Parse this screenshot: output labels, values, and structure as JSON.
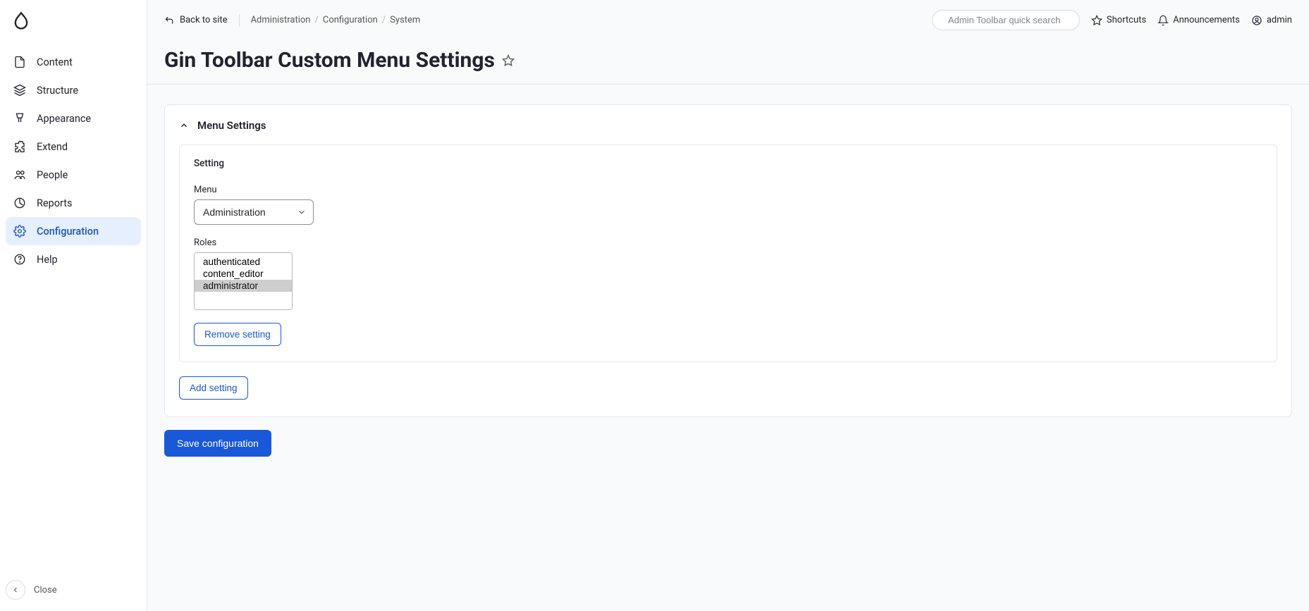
{
  "sidebar": {
    "items": [
      {
        "label": "Content"
      },
      {
        "label": "Structure"
      },
      {
        "label": "Appearance"
      },
      {
        "label": "Extend"
      },
      {
        "label": "People"
      },
      {
        "label": "Reports"
      },
      {
        "label": "Configuration"
      },
      {
        "label": "Help"
      }
    ],
    "close_label": "Close"
  },
  "topbar": {
    "back_label": "Back to site",
    "breadcrumbs": [
      "Administration",
      "Configuration",
      "System"
    ],
    "search_placeholder": "Admin Toolbar quick search",
    "shortcuts_label": "Shortcuts",
    "announcements_label": "Announcements",
    "user_label": "admin"
  },
  "page": {
    "title": "Gin Toolbar Custom Menu Settings"
  },
  "form": {
    "section_title": "Menu Settings",
    "setting_heading": "Setting",
    "menu_label": "Menu",
    "menu_selected": "Administration",
    "roles_label": "Roles",
    "roles_options": [
      "authenticated",
      "content_editor",
      "administrator"
    ],
    "roles_selected": "administrator",
    "remove_button": "Remove setting",
    "add_button": "Add setting",
    "save_button": "Save configuration"
  }
}
